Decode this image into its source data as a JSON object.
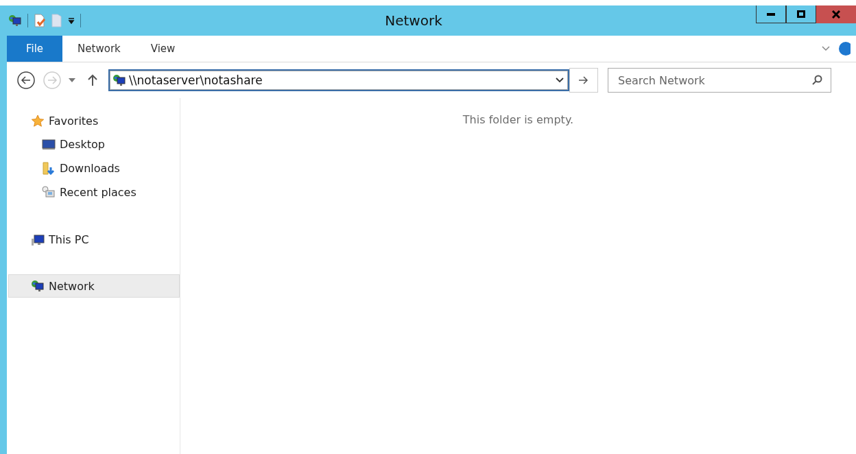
{
  "window": {
    "title": "Network"
  },
  "ribbon": {
    "tabs": [
      {
        "label": "File",
        "selected": true
      },
      {
        "label": "Network",
        "selected": false
      },
      {
        "label": "View",
        "selected": false
      }
    ]
  },
  "address_bar": {
    "value": "\\\\notaserver\\notashare"
  },
  "search": {
    "placeholder": "Search Network"
  },
  "sidebar": {
    "items": [
      {
        "label": "Favorites",
        "kind": "star",
        "selected": false,
        "children": [
          {
            "label": "Desktop",
            "kind": "desktop",
            "selected": false
          },
          {
            "label": "Downloads",
            "kind": "downloads",
            "selected": false
          },
          {
            "label": "Recent places",
            "kind": "recent",
            "selected": false
          }
        ]
      },
      {
        "label": "This PC",
        "kind": "pc",
        "selected": false
      },
      {
        "label": "Network",
        "kind": "network",
        "selected": true
      }
    ]
  },
  "content": {
    "message": "This folder is empty."
  }
}
